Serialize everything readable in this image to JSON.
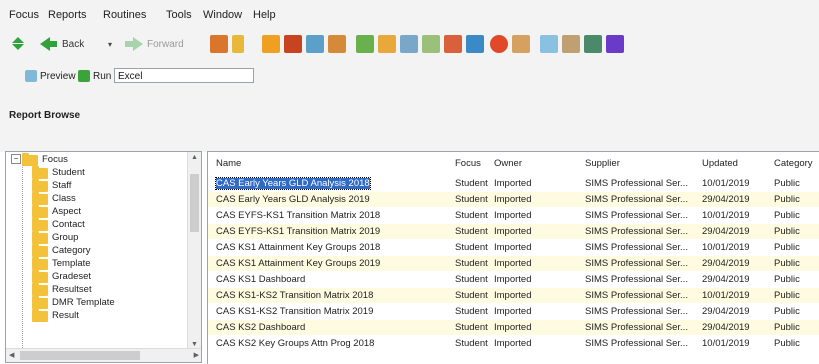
{
  "menu": [
    "Focus",
    "Reports",
    "Routines",
    "Tools",
    "Window",
    "Help"
  ],
  "toolbar": {
    "back_label": "Back",
    "forward_label": "Forward",
    "icons": [
      "people-icon",
      "person-icon",
      "report-book-icon",
      "flag-icon",
      "chart-icon",
      "group-icon",
      "books-icon",
      "list-icon",
      "window-icon",
      "edit-icon",
      "group2-icon",
      "home-icon",
      "clock-icon",
      "user-icon",
      "mail-icon",
      "card-icon",
      "chart2-icon",
      "purple-icon"
    ]
  },
  "runbar": {
    "preview_label": "Preview",
    "run_label": "Run",
    "output_value": "Excel"
  },
  "panel_title": "Report Browse",
  "tree": {
    "root": "Focus",
    "items": [
      "Student",
      "Staff",
      "Class",
      "Aspect",
      "Contact",
      "Group",
      "Category",
      "Template",
      "Gradeset",
      "Resultset",
      "DMR Template",
      "Result"
    ]
  },
  "grid": {
    "columns": [
      "Name",
      "Focus",
      "Owner",
      "Supplier",
      "Updated",
      "Category"
    ],
    "rows": [
      {
        "name": "CAS Early Years GLD Analysis 2018",
        "focus": "Student",
        "owner": "Imported",
        "supplier": "SIMS Professional Ser...",
        "updated": "10/01/2019",
        "category": "Public"
      },
      {
        "name": "CAS Early Years GLD Analysis 2019",
        "focus": "Student",
        "owner": "Imported",
        "supplier": "SIMS Professional Ser...",
        "updated": "29/04/2019",
        "category": "Public"
      },
      {
        "name": "CAS EYFS-KS1 Transition Matrix 2018",
        "focus": "Student",
        "owner": "Imported",
        "supplier": "SIMS Professional Ser...",
        "updated": "10/01/2019",
        "category": "Public"
      },
      {
        "name": "CAS EYFS-KS1 Transition Matrix 2019",
        "focus": "Student",
        "owner": "Imported",
        "supplier": "SIMS Professional Ser...",
        "updated": "29/04/2019",
        "category": "Public"
      },
      {
        "name": "CAS KS1 Attainment Key Groups 2018",
        "focus": "Student",
        "owner": "Imported",
        "supplier": "SIMS Professional Ser...",
        "updated": "10/01/2019",
        "category": "Public"
      },
      {
        "name": "CAS KS1 Attainment Key Groups 2019",
        "focus": "Student",
        "owner": "Imported",
        "supplier": "SIMS Professional Ser...",
        "updated": "29/04/2019",
        "category": "Public"
      },
      {
        "name": "CAS KS1 Dashboard",
        "focus": "Student",
        "owner": "Imported",
        "supplier": "SIMS Professional Ser...",
        "updated": "29/04/2019",
        "category": "Public"
      },
      {
        "name": "CAS KS1-KS2 Transition Matrix 2018",
        "focus": "Student",
        "owner": "Imported",
        "supplier": "SIMS Professional Ser...",
        "updated": "10/01/2019",
        "category": "Public"
      },
      {
        "name": "CAS KS1-KS2 Transition Matrix 2019",
        "focus": "Student",
        "owner": "Imported",
        "supplier": "SIMS Professional Ser...",
        "updated": "29/04/2019",
        "category": "Public"
      },
      {
        "name": "CAS KS2 Dashboard",
        "focus": "Student",
        "owner": "Imported",
        "supplier": "SIMS Professional Ser...",
        "updated": "29/04/2019",
        "category": "Public"
      },
      {
        "name": "CAS KS2 Key Groups Attn Prog 2018",
        "focus": "Student",
        "owner": "Imported",
        "supplier": "SIMS Professional Ser...",
        "updated": "10/01/2019",
        "category": "Public"
      }
    ]
  },
  "colors": {
    "chrome": "#f3f3f3",
    "selection": "#2f6ac6",
    "alt_row": "#fffbe0",
    "folder": "#f3c23a"
  }
}
